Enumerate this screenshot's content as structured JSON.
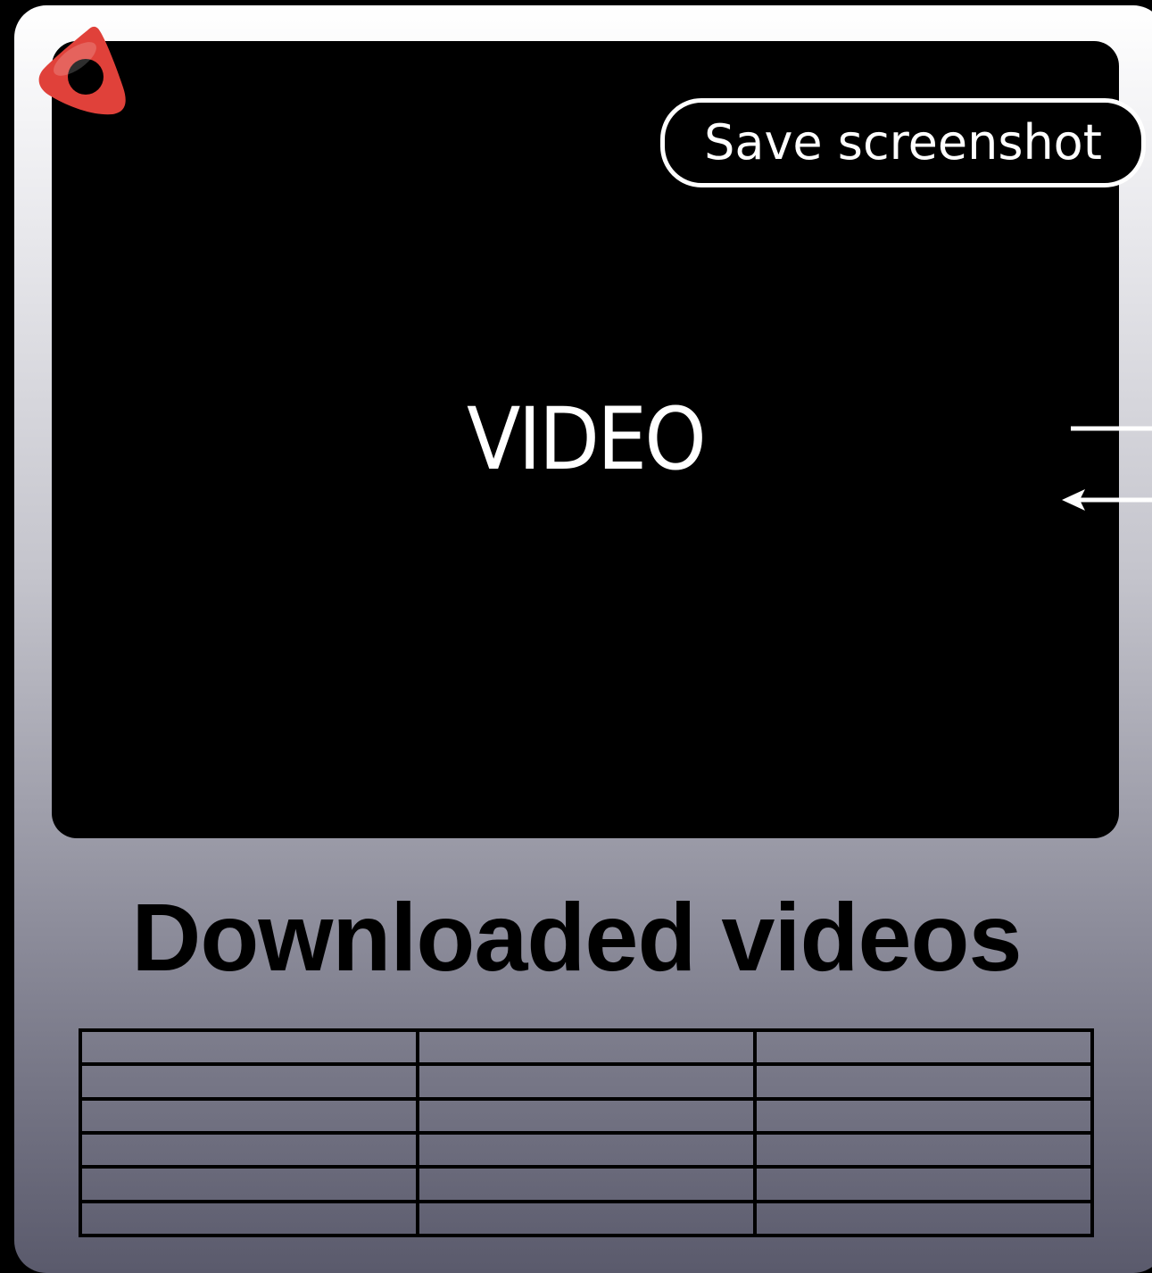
{
  "app": {
    "logo_icon": "adobe-air-logo-icon",
    "logo_color": "#e0413a"
  },
  "video": {
    "label": "VIDEO"
  },
  "toolbar": {
    "save_screenshot_label": "Save screenshot"
  },
  "downloads": {
    "title": "Downloaded videos",
    "columns": [
      "",
      "",
      ""
    ],
    "rows": [
      [
        "",
        "",
        ""
      ],
      [
        "",
        "",
        ""
      ],
      [
        "",
        "",
        ""
      ],
      [
        "",
        "",
        ""
      ],
      [
        "",
        "",
        ""
      ],
      [
        "",
        "",
        ""
      ]
    ]
  },
  "connector": {
    "icon": "arrow-left-icon"
  }
}
